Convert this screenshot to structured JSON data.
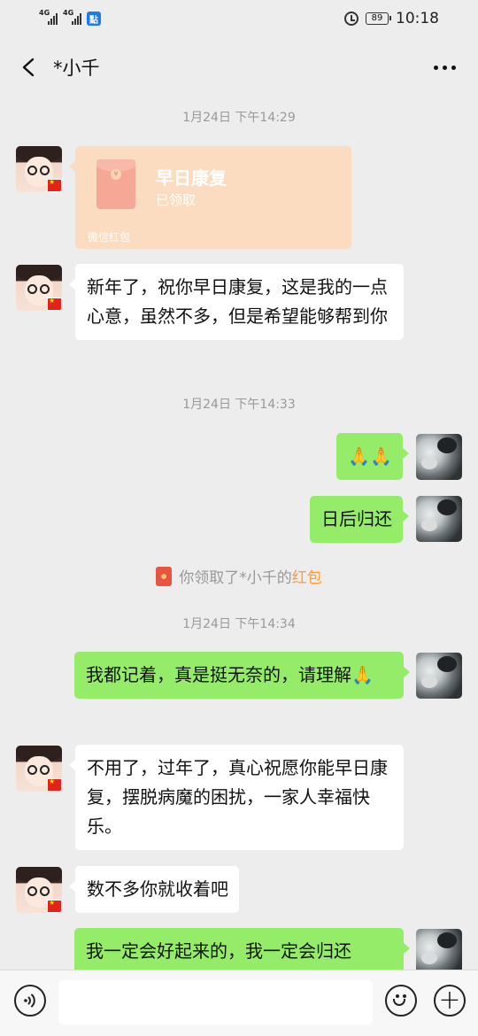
{
  "status_bar": {
    "network_1": "4G",
    "network_2": "4G",
    "app_badge": "點",
    "battery": "89",
    "time": "10:18"
  },
  "header": {
    "title": "*小千"
  },
  "messages": {
    "ts1": "1月24日 下午14:29",
    "red_packet": {
      "title": "早日康复",
      "status": "已领取",
      "footer": "微信红包",
      "coin": "¥"
    },
    "msg1": "新年了，祝你早日康复，这是我的一点心意，虽然不多，但是希望能够帮到你",
    "ts2": "1月24日 下午14:33",
    "msg2": "🙏🙏",
    "msg3": "日后归还",
    "notice_prefix": "你领取了*小千的",
    "notice_link": "红包",
    "ts3": "1月24日 下午14:34",
    "msg4": "我都记着，真是挺无奈的，请理解🙏",
    "msg5": "不用了，过年了，真心祝愿你能早日康复，摆脱病魔的困扰，一家人幸福快乐。",
    "msg6": "数不多你就收着吧",
    "msg7": "我一定会好起来的，我一定会归还"
  },
  "input_bar": {
    "plus": "+"
  },
  "colors": {
    "bg": "#ededed",
    "my_bubble": "#95ec69",
    "their_bubble": "#ffffff",
    "red_packet_received": "#fbdcc1",
    "highlight": "#fa9d3b"
  }
}
